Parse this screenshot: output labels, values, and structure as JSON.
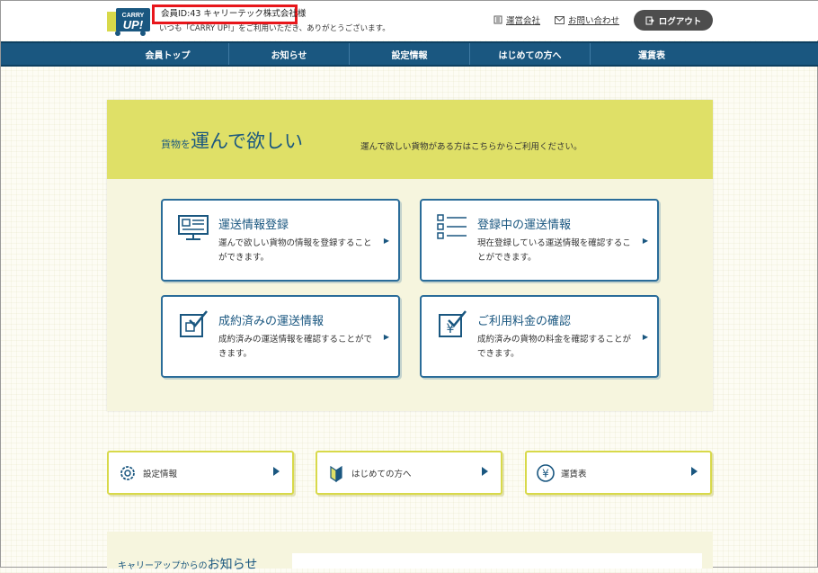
{
  "header": {
    "logo_text": "CARRY UP!",
    "member_info": "会員ID:43 キャリーテック株式会社様",
    "greeting": "いつも「CARRY UP!」をご利用いただき、ありがとうございます。",
    "company_link": "運営会社",
    "contact_link": "お問い合わせ",
    "logout_label": "ログアウト"
  },
  "nav": {
    "items": [
      {
        "label": "会員トップ"
      },
      {
        "label": "お知らせ"
      },
      {
        "label": "設定情報"
      },
      {
        "label": "はじめての方へ"
      },
      {
        "label": "運賃表"
      }
    ]
  },
  "banner": {
    "title_small": "貨物を",
    "title_big": "運んで欲しい",
    "subtitle": "運んで欲しい貨物がある方はこちらからご利用ください。"
  },
  "cards": [
    {
      "title": "運送情報登録",
      "desc": "運んで欲しい貨物の情報を登録することができます。",
      "icon": "monitor-icon"
    },
    {
      "title": "登録中の運送情報",
      "desc": "現在登録している運送情報を確認することができます。",
      "icon": "checklist-icon"
    },
    {
      "title": "成約済みの運送情報",
      "desc": "成約済みの運送情報を確認することができます。",
      "icon": "checked-box-icon"
    },
    {
      "title": "ご利用料金の確認",
      "desc": "成約済みの貨物の料金を確認することができます。",
      "icon": "yen-check-icon"
    }
  ],
  "lower_buttons": [
    {
      "label": "設定情報",
      "icon": "gear-icon"
    },
    {
      "label": "はじめての方へ",
      "icon": "beginner-mark-icon"
    },
    {
      "label": "運賃表",
      "icon": "yen-circle-icon"
    }
  ],
  "news": {
    "title_small": "キャリーアップからの",
    "title_big": "お知らせ"
  },
  "colors": {
    "nav_bg": "#1a5780",
    "banner_bg": "#dfe067",
    "member_box_border": "#e8161b",
    "card_border": "#2a6c99"
  }
}
